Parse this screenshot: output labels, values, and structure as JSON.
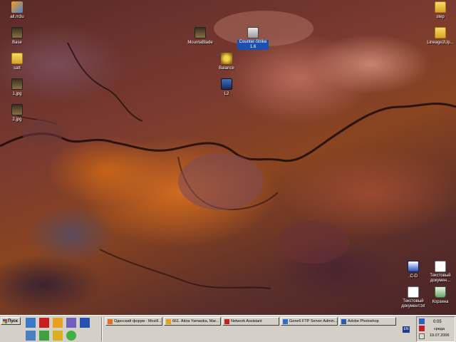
{
  "desktop": {
    "icons": [
      {
        "label": "all.m3u",
        "type": "draw"
      },
      {
        "label": "Base",
        "type": "game"
      },
      {
        "label": "satt",
        "type": "folder"
      },
      {
        "label": "1.jpg",
        "type": "game"
      },
      {
        "label": "2.jpg",
        "type": "game"
      },
      {
        "label": "MountaBlade",
        "type": "game"
      },
      {
        "label": "Counter-Strike 1.6",
        "type": "cs"
      },
      {
        "label": "Balance",
        "type": "gear"
      },
      {
        "label": "L2",
        "type": "l2"
      },
      {
        "label": "step",
        "type": "folder"
      },
      {
        "label": "Lineage2Up...",
        "type": "folder"
      },
      {
        "label": ".C-D",
        "type": "dotc"
      },
      {
        "label": "Текстовый докумен...",
        "type": "doc"
      },
      {
        "label": "Текстовый документ.txt",
        "type": "doc"
      },
      {
        "label": "Корзина",
        "type": "bin"
      }
    ]
  },
  "taskbar": {
    "start_label": "Пуск",
    "quick_launch": [
      {
        "name": "show-desktop-icon",
        "color": "#3a78c8"
      },
      {
        "name": "opera-icon",
        "color": "#c81e1e"
      },
      {
        "name": "pencil-icon",
        "color": "#e8a020"
      },
      {
        "name": "winamp-icon",
        "color": "#7060c0"
      },
      {
        "name": "network-icon",
        "color": "#2850b0"
      },
      {
        "name": "computer-icon",
        "color": "#4a80c0"
      },
      {
        "name": "hand-icon",
        "color": "#40a040"
      },
      {
        "name": "users-icon",
        "color": "#d8b020"
      },
      {
        "name": "icq-icon",
        "color": "#40b040"
      }
    ],
    "tasks": [
      {
        "label": "Одесский форум - Mozill...",
        "icon_color": "#e07020"
      },
      {
        "label": "661. Akira Yamaoka, Mar...",
        "icon_color": "#e8a020"
      },
      {
        "label": "Network Assistant",
        "icon_color": "#c81e1e"
      },
      {
        "label": "Gene6 FTP Server Admin...",
        "icon_color": "#3070c0"
      },
      {
        "label": "Adobe Photoshop",
        "icon_color": "#2a5aa8"
      }
    ],
    "tray": {
      "language": "EN",
      "time": "0:05",
      "day": "среда",
      "date": "19.07.2006"
    }
  }
}
